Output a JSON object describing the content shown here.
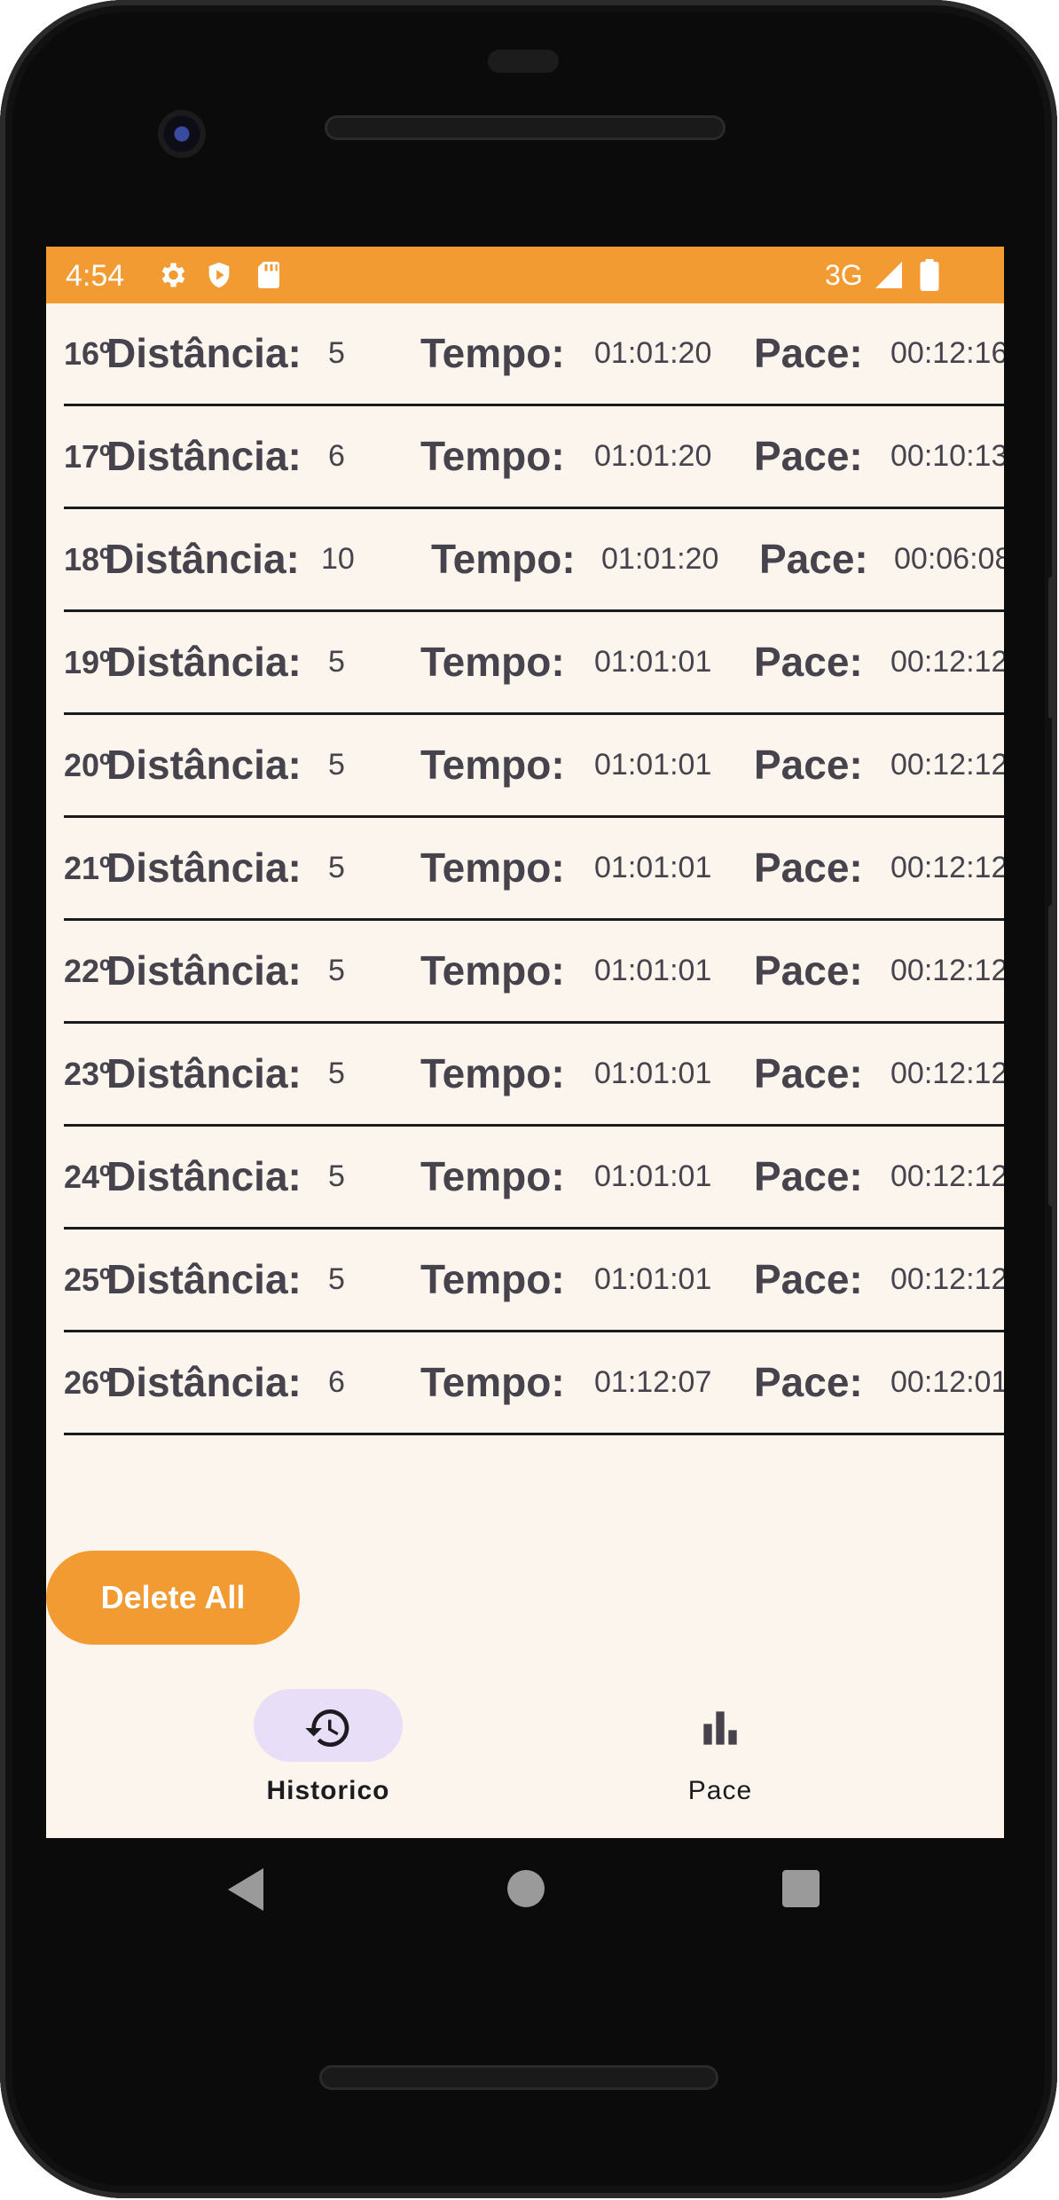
{
  "status_bar": {
    "time": "4:54",
    "network": "3G",
    "icons": [
      "gear-icon",
      "shield-play-icon",
      "sd-card-icon",
      "signal-icon",
      "battery-icon"
    ],
    "background_color": "#f19b32"
  },
  "labels": {
    "distance": "Distância:",
    "time": "Tempo:",
    "pace": "Pace:"
  },
  "entries": [
    {
      "index": "16º",
      "distance": "5",
      "time": "01:01:20",
      "pace": "00:12:16"
    },
    {
      "index": "17º",
      "distance": "6",
      "time": "01:01:20",
      "pace": "00:10:13"
    },
    {
      "index": "18º",
      "distance": "10",
      "time": "01:01:20",
      "pace": "00:06:08"
    },
    {
      "index": "19º",
      "distance": "5",
      "time": "01:01:01",
      "pace": "00:12:12"
    },
    {
      "index": "20º",
      "distance": "5",
      "time": "01:01:01",
      "pace": "00:12:12"
    },
    {
      "index": "21º",
      "distance": "5",
      "time": "01:01:01",
      "pace": "00:12:12"
    },
    {
      "index": "22º",
      "distance": "5",
      "time": "01:01:01",
      "pace": "00:12:12"
    },
    {
      "index": "23º",
      "distance": "5",
      "time": "01:01:01",
      "pace": "00:12:12"
    },
    {
      "index": "24º",
      "distance": "5",
      "time": "01:01:01",
      "pace": "00:12:12"
    },
    {
      "index": "25º",
      "distance": "5",
      "time": "01:01:01",
      "pace": "00:12:12"
    },
    {
      "index": "26º",
      "distance": "6",
      "time": "01:12:07",
      "pace": "00:12:01"
    }
  ],
  "delete_button": {
    "label": "Delete All",
    "color": "#f19b32"
  },
  "bottom_nav": {
    "items": [
      {
        "label": "Historico",
        "icon": "history-icon",
        "selected": true
      },
      {
        "label": "Pace",
        "icon": "bar-chart-icon",
        "selected": false
      }
    ],
    "selected_pill_color": "#e8def8"
  },
  "system_nav": {
    "icons": [
      "back-icon",
      "home-icon",
      "recents-icon"
    ]
  }
}
